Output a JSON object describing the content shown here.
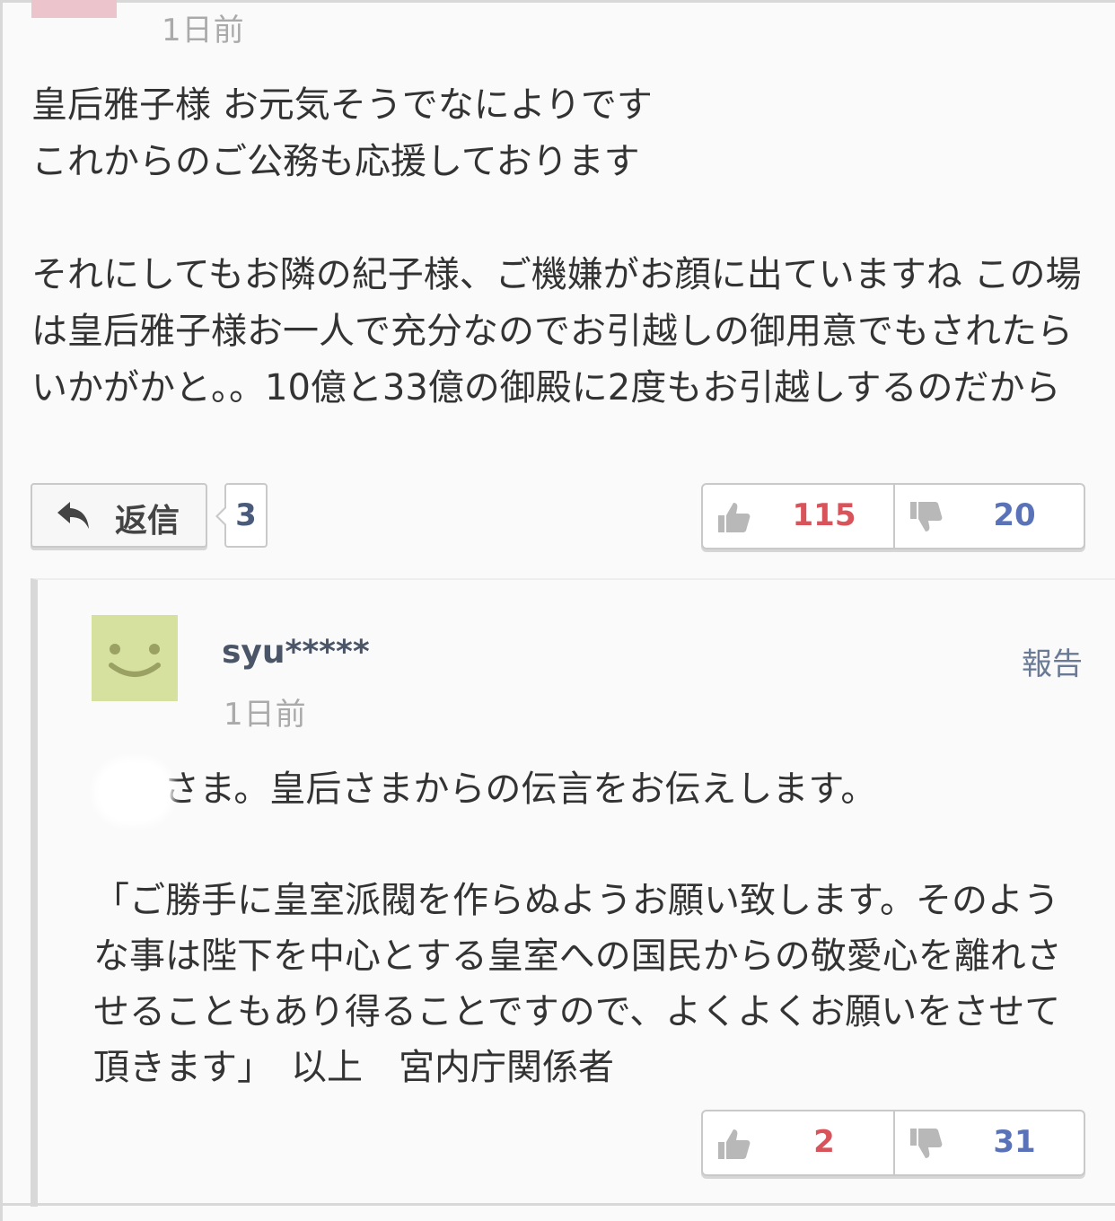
{
  "comment": {
    "time": "1日前",
    "body": "皇后雅子様 お元気そうでなによりです\nこれからのご公務も応援しております\n\nそれにしてもお隣の紀子様、ご機嫌がお顔に出ていますね この場は皇后雅子様お一人で充分なのでお引越しの御用意でもされたらいかがかと。。10億と33億の御殿に2度もお引越しするのだから",
    "reply_label": "返信",
    "reply_count": "3",
    "likes": "115",
    "dislikes": "20"
  },
  "reply": {
    "username": "syu*****",
    "time": "1日前",
    "report_label": "報告",
    "line1": "さま。皇后さまからの伝言をお伝えします。",
    "body": "「ご勝手に皇室派閥を作らぬようお願い致します。そのような事は陛下を中心とする皇室への国民からの敬愛心を離れさせることもあり得ることですので、よくよくお願いをさせて頂きます」　以上　宮内庁関係者",
    "likes": "2",
    "dislikes": "31"
  },
  "colors": {
    "like": "#d9535b",
    "dislike": "#5a73b8",
    "avatar": "#d6e19f"
  },
  "icons": [
    "reply-arrow-icon",
    "thumbs-up-icon",
    "thumbs-down-icon",
    "smiley-avatar-icon"
  ]
}
